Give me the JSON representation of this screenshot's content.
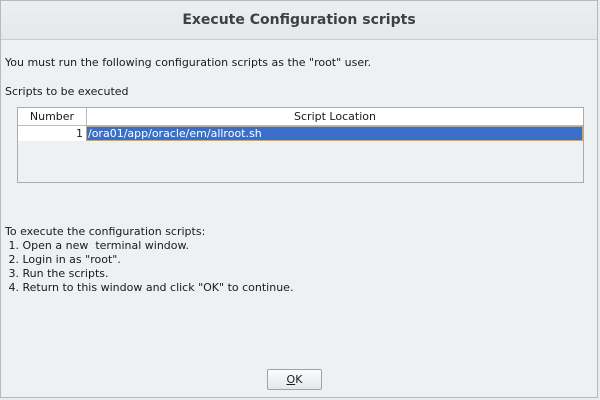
{
  "window": {
    "title": "Execute Configuration scripts"
  },
  "intro_text": "You must run the following configuration scripts as the \"root\" user.",
  "scripts_label": "Scripts to be executed",
  "table": {
    "columns": [
      "Number",
      "Script Location"
    ],
    "rows": [
      {
        "number": "1",
        "location": "/ora01/app/oracle/em/allroot.sh",
        "selected": true
      }
    ]
  },
  "instructions": {
    "heading": "To execute the configuration scripts:",
    "steps": [
      " 1. Open a new  terminal window.",
      " 2. Login in as \"root\".",
      " 3. Run the scripts.",
      " 4. Return to this window and click \"OK\" to continue."
    ]
  },
  "buttons": {
    "ok_mnemonic": "O",
    "ok_rest": "K"
  },
  "colors": {
    "selection_bg": "#3a6fc9",
    "selection_border": "#e1a542",
    "window_bg": "#edf1f3"
  }
}
